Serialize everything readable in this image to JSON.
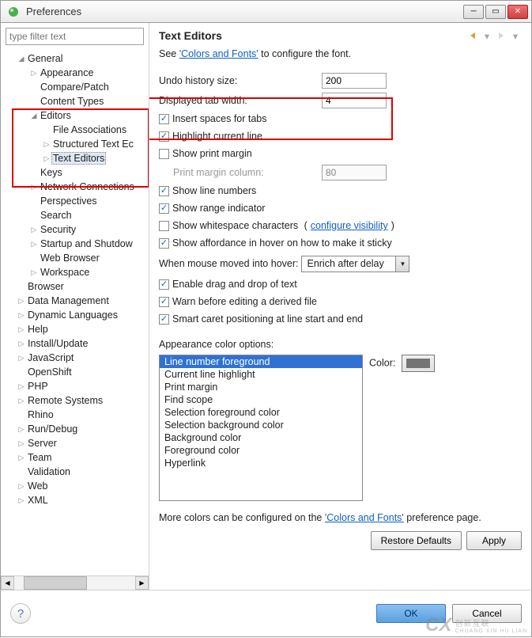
{
  "window": {
    "title": "Preferences"
  },
  "sidebar": {
    "filter_placeholder": "type filter text",
    "items": {
      "general": "General",
      "appearance": "Appearance",
      "compare_patch": "Compare/Patch",
      "content_types": "Content Types",
      "editors": "Editors",
      "file_associations": "File Associations",
      "structured_text": "Structured Text Ec",
      "text_editors": "Text Editors",
      "keys": "Keys",
      "network": "Network Connections",
      "perspectives": "Perspectives",
      "search": "Search",
      "security": "Security",
      "startup": "Startup and Shutdow",
      "web_browser": "Web Browser",
      "workspace": "Workspace",
      "browser": "Browser",
      "data_mgmt": "Data Management",
      "dyn_lang": "Dynamic Languages",
      "help": "Help",
      "install": "Install/Update",
      "javascript": "JavaScript",
      "openshift": "OpenShift",
      "php": "PHP",
      "remote": "Remote Systems",
      "rhino": "Rhino",
      "rundebug": "Run/Debug",
      "server": "Server",
      "team": "Team",
      "validation": "Validation",
      "web": "Web",
      "xml": "XML"
    }
  },
  "content": {
    "heading": "Text Editors",
    "config_prefix": "See ",
    "config_link": "'Colors and Fonts'",
    "config_suffix": " to configure the font.",
    "undo_label": "Undo history size:",
    "undo_value": "200",
    "tab_label": "Displayed tab width:",
    "tab_value": "4",
    "spaces_label": "Insert spaces for tabs",
    "highlight_label": "Highlight current line",
    "print_label": "Show print margin",
    "print_col_label": "Print margin column:",
    "print_col_value": "80",
    "line_numbers": "Show line numbers",
    "range_ind": "Show range indicator",
    "whitespace": "Show whitespace characters",
    "whitespace_link": "configure visibility",
    "affordance": "Show affordance in hover on how to make it sticky",
    "hover_label": "When mouse moved into hover: ",
    "hover_value": "Enrich after delay",
    "dnd": "Enable drag and drop of text",
    "warn_derived": "Warn before editing a derived file",
    "smart_caret": "Smart caret positioning at line start and end",
    "color_opts_label": "Appearance color options:",
    "color_label": "Color:",
    "options": [
      "Line number foreground",
      "Current line highlight",
      "Print margin",
      "Find scope",
      "Selection foreground color",
      "Selection background color",
      "Background color",
      "Foreground color",
      "Hyperlink"
    ],
    "more_colors_prefix": "More colors can be configured on the ",
    "more_colors_link": "'Colors and Fonts'",
    "more_colors_suffix": " preference page.",
    "restore": "Restore Defaults",
    "apply": "Apply"
  },
  "footer": {
    "ok": "OK",
    "cancel": "Cancel"
  },
  "watermark": {
    "big": "CX",
    "small1": "创新互联",
    "small2": "CHUANG XIN HU LIAN"
  }
}
